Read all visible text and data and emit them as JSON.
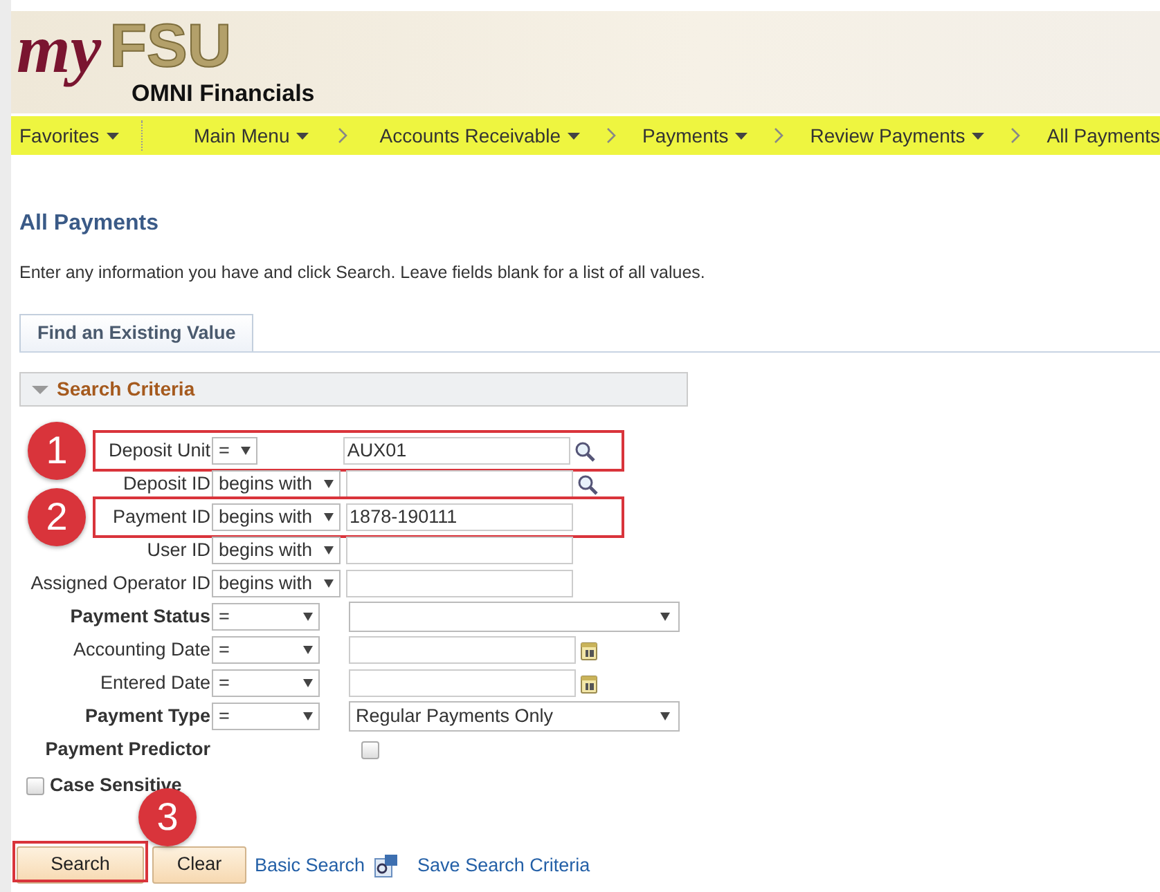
{
  "header": {
    "logo": {
      "part_1": "my",
      "part_2": "FSU"
    },
    "subtitle": "OMNI Financials"
  },
  "breadcrumb": [
    {
      "label": "Favorites",
      "dropdown": true,
      "separator": false
    },
    {
      "label": "Main Menu",
      "dropdown": true,
      "separator": false
    },
    {
      "label": "Accounts Receivable",
      "dropdown": true,
      "separator": true
    },
    {
      "label": "Payments",
      "dropdown": true,
      "separator": true
    },
    {
      "label": "Review Payments",
      "dropdown": true,
      "separator": true
    },
    {
      "label": "All Payments",
      "dropdown": false,
      "separator": true
    }
  ],
  "page": {
    "title": "All Payments",
    "instructions": "Enter any information you have and click Search. Leave fields blank for a list of all values."
  },
  "tabs": [
    {
      "label": "Find an Existing Value",
      "selected": true
    }
  ],
  "section": {
    "title": "Search Criteria",
    "expanded": true
  },
  "fields": [
    {
      "kind": "lookup",
      "label": "Deposit Unit",
      "bold": false,
      "operator": "=",
      "value": "AUX01",
      "callout": "1"
    },
    {
      "kind": "lookup",
      "label": "Deposit ID",
      "bold": false,
      "operator": "begins with"
    },
    {
      "kind": "text",
      "label": "Payment ID",
      "bold": false,
      "operator": "begins with",
      "value": "1878-190111",
      "callout": "2"
    },
    {
      "kind": "text",
      "label": "User ID",
      "bold": false,
      "operator": "begins with"
    },
    {
      "kind": "text",
      "label": "Assigned Operator ID",
      "bold": false,
      "operator": "begins with"
    },
    {
      "kind": "select",
      "label": "Payment Status",
      "bold": true,
      "operator": "="
    },
    {
      "kind": "date",
      "label": "Accounting Date",
      "bold": false,
      "operator": "="
    },
    {
      "kind": "date",
      "label": "Entered Date",
      "bold": false,
      "operator": "="
    },
    {
      "kind": "select",
      "label": "Payment Type",
      "bold": true,
      "operator": "=",
      "value": "Regular Payments Only"
    },
    {
      "kind": "checkbox",
      "label": "Payment Predictor",
      "bold": true,
      "checked": false
    }
  ],
  "case_sensitive": {
    "label": "Case Sensitive",
    "checked": false
  },
  "actions": [
    {
      "kind": "button",
      "label": "Search",
      "callout": "3"
    },
    {
      "kind": "button",
      "label": "Clear"
    },
    {
      "kind": "link",
      "label": "Basic Search"
    },
    {
      "kind": "icon-link",
      "label": "Save Search Criteria"
    }
  ]
}
